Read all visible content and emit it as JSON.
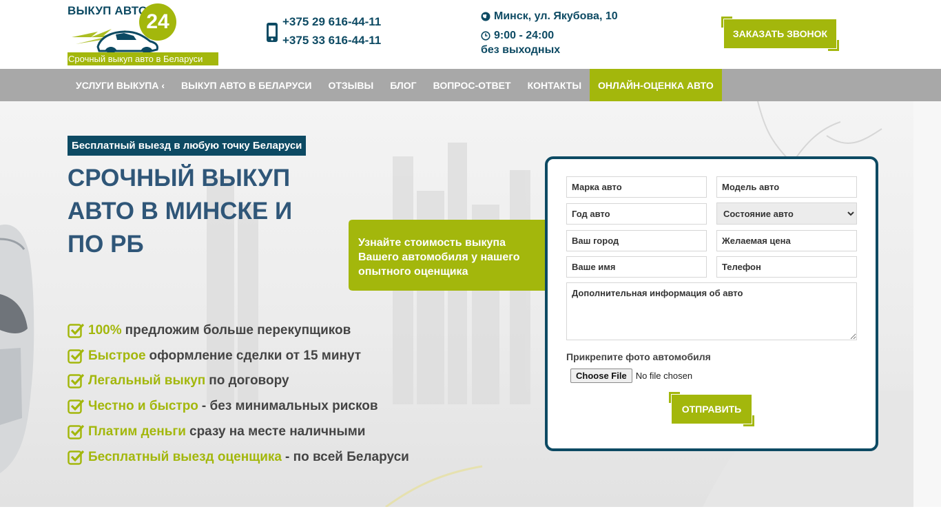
{
  "header": {
    "logo": {
      "title": "ВЫКУП АВТО",
      "number": "24",
      "tagline": "Срочный выкуп авто в Беларуси"
    },
    "phones": [
      "+375 29 616-44-11",
      "+375 33 616-44-11"
    ],
    "address": "Минск, ул. Якубова, 10",
    "hours": "9:00 - 24:00",
    "days": "без выходных",
    "callback_label": "ЗАКАЗАТЬ ЗВОНОК"
  },
  "nav": {
    "items": [
      {
        "label": "УСЛУГИ ВЫКУПА ‹"
      },
      {
        "label": "ВЫКУП АВТО В БЕЛАРУСИ"
      },
      {
        "label": "ОТЗЫВЫ"
      },
      {
        "label": "БЛОГ"
      },
      {
        "label": "ВОПРОС-ОТВЕТ"
      },
      {
        "label": "КОНТАКТЫ"
      },
      {
        "label": "ОНЛАЙН-ОЦЕНКА АВТО"
      }
    ]
  },
  "hero": {
    "badge": "Бесплатный выезд в любую точку Беларуси",
    "title": "СРОЧНЫЙ ВЫКУП АВТО В МИНСКЕ И ПО РБ",
    "callout": "Узнайте стоимость выкупа Вашего автомобиля у нашего опытного оценщика",
    "features": [
      {
        "highlight": "100%",
        "text": "предложим больше перекупщиков"
      },
      {
        "highlight": "Быстрое",
        "text": "оформление сделки от 15 минут"
      },
      {
        "highlight": "Легальный выкуп",
        "text": "по договору"
      },
      {
        "highlight": "Честно и быстро",
        "text": "- без минимальных рисков"
      },
      {
        "highlight": "Платим деньги",
        "text": "сразу на месте наличными"
      },
      {
        "highlight": "Бесплатный выезд оценщика",
        "text": "- по всей Беларуси"
      }
    ]
  },
  "form": {
    "brand_placeholder": "Марка авто",
    "model_placeholder": "Модель авто",
    "year_placeholder": "Год авто",
    "condition_selected": "Состояние авто",
    "city_placeholder": "Ваш город",
    "price_placeholder": "Желаемая цена",
    "name_placeholder": "Ваше имя",
    "phone_placeholder": "Телефон",
    "info_placeholder": "Дополнительная информация об авто",
    "photo_label": "Прикрепите фото автомобиля",
    "file_button": "Choose File",
    "file_status": "No file chosen",
    "submit_label": "ОТПРАВИТЬ"
  },
  "colors": {
    "accent": "#a3b70c",
    "brand_dark": "#0d4a63",
    "title": "#2f5678",
    "nav_bg": "#a8a8a8"
  },
  "icons": {
    "phone": "mobile-phone-icon",
    "location": "globe-icon",
    "hours": "clock-icon",
    "feature": "check-square-icon"
  }
}
